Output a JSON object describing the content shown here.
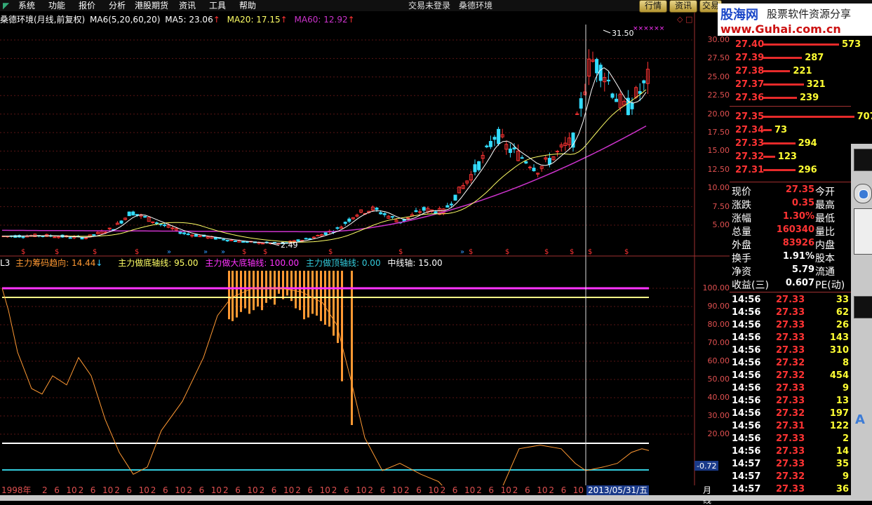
{
  "menu": [
    "系统",
    "功能",
    "报价",
    "分析",
    "港股期货",
    "资讯",
    "工具",
    "帮助"
  ],
  "login_status": "交易未登录",
  "window_title": "桑德环境",
  "tabs": [
    "行情",
    "资讯",
    "交易"
  ],
  "logo": {
    "brand": "股海网",
    "slogan": "股票软件资源分享",
    "url": "www.Guhai.com.cn"
  },
  "main_chart": {
    "stock": "桑德环境(月线,前复权)",
    "ma_group": "MA6(5,20,60,20)",
    "ma5_label": "MA5: 23.06",
    "ma20_label": "MA20: 17.15",
    "ma60_label": "MA60: 12.92",
    "high_label": "31.50",
    "low_label": "2.49",
    "y_ticks": [
      "30.00",
      "27.50",
      "25.00",
      "22.50",
      "20.00",
      "17.50",
      "15.00",
      "12.50",
      "10.00",
      "7.50",
      "5.00"
    ]
  },
  "indicator": {
    "name": "L3",
    "trend_label": "主力筹码趋向: 14.44",
    "bottom_axis_label": "主力做底轴线: 95.00",
    "big_bottom_label": "主力做大底轴线: 100.00",
    "top_axis_label": "主力做顶轴线: 0.00",
    "mid_axis_label": "中线轴: 15.00",
    "y_ticks": [
      "100.00",
      "90.00",
      "80.00",
      "70.00",
      "60.00",
      "50.00",
      "40.00",
      "30.00",
      "20.00"
    ],
    "cursor_value": "-0.72"
  },
  "x_axis": {
    "start": "1998年",
    "cursor_date": "2013/05/31/五",
    "period": "月线",
    "labels": [
      "2",
      "6",
      "10",
      "2",
      "6",
      "10",
      "2",
      "6",
      "10",
      "2",
      "6",
      "10",
      "2",
      "6",
      "10",
      "2",
      "6",
      "10",
      "2",
      "6",
      "10",
      "2",
      "6",
      "10",
      "2",
      "6",
      "10",
      "2",
      "6",
      "10",
      "2",
      "6",
      "10",
      "2",
      "6",
      "10",
      "2",
      "6",
      "10",
      "2",
      "6",
      "10",
      "2",
      "6",
      "10"
    ]
  },
  "order_book": {
    "asks": [
      {
        "price": "27.40",
        "vol": "573"
      },
      {
        "price": "27.39",
        "vol": "287"
      },
      {
        "price": "27.38",
        "vol": "221"
      },
      {
        "price": "27.37",
        "vol": "321"
      },
      {
        "price": "27.36",
        "vol": "239"
      }
    ],
    "bids": [
      {
        "price": "27.35",
        "vol": "707"
      },
      {
        "price": "27.34",
        "vol": "73"
      },
      {
        "price": "27.33",
        "vol": "294"
      },
      {
        "price": "27.32",
        "vol": "123"
      },
      {
        "price": "27.31",
        "vol": "296"
      }
    ]
  },
  "quote": [
    {
      "k": "现价",
      "v": "27.35",
      "k2": "今开"
    },
    {
      "k": "涨跌",
      "v": "0.35",
      "k2": "最高"
    },
    {
      "k": "涨幅",
      "v": "1.30%",
      "k2": "最低"
    },
    {
      "k": "总量",
      "v": "160340",
      "k2": "量比"
    },
    {
      "k": "外盘",
      "v": "83926",
      "k2": "内盘"
    },
    {
      "k": "换手",
      "v": "1.91%",
      "k2": "股本"
    },
    {
      "k": "净资",
      "v": "5.79",
      "k2": "流通"
    },
    {
      "k": "收益(三)",
      "v": "0.607",
      "k2": "PE(动)"
    }
  ],
  "ticks": [
    {
      "t": "14:56",
      "p": "27.33",
      "v": "33"
    },
    {
      "t": "14:56",
      "p": "27.33",
      "v": "62"
    },
    {
      "t": "14:56",
      "p": "27.33",
      "v": "26"
    },
    {
      "t": "14:56",
      "p": "27.33",
      "v": "143"
    },
    {
      "t": "14:56",
      "p": "27.33",
      "v": "310"
    },
    {
      "t": "14:56",
      "p": "27.32",
      "v": "8"
    },
    {
      "t": "14:56",
      "p": "27.32",
      "v": "454"
    },
    {
      "t": "14:56",
      "p": "27.33",
      "v": "9"
    },
    {
      "t": "14:56",
      "p": "27.33",
      "v": "13"
    },
    {
      "t": "14:56",
      "p": "27.32",
      "v": "197"
    },
    {
      "t": "14:56",
      "p": "27.31",
      "v": "122"
    },
    {
      "t": "14:56",
      "p": "27.33",
      "v": "2"
    },
    {
      "t": "14:56",
      "p": "27.33",
      "v": "14"
    },
    {
      "t": "14:57",
      "p": "27.33",
      "v": "35"
    },
    {
      "t": "14:57",
      "p": "27.32",
      "v": "9"
    },
    {
      "t": "14:57",
      "p": "27.33",
      "v": "36"
    }
  ],
  "colors": {
    "up": "#ff3333",
    "down": "#33ddff",
    "ma5": "#ffffff",
    "ma20": "#ffff66",
    "ma60": "#cc33cc",
    "indicator": "#ff9933",
    "axis": "#e05050"
  }
}
